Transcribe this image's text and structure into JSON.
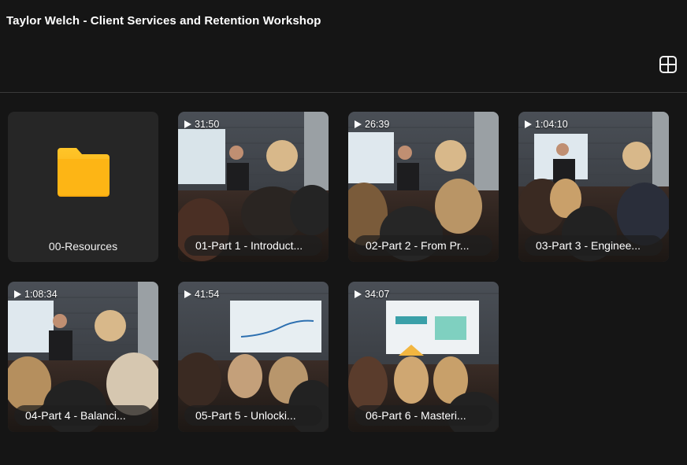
{
  "header": {
    "title": "Taylor Welch - Client Services and Retention Workshop"
  },
  "icons": {
    "layout_toggle": "grid-layout-icon",
    "folder": "folder-icon",
    "play": "play-icon"
  },
  "colors": {
    "background": "#151515",
    "tile": "#232323",
    "folder": "#fbb91a"
  },
  "folder": {
    "label": "00-Resources"
  },
  "videos": [
    {
      "duration": "31:50",
      "label": "01-Part 1 - Introduct..."
    },
    {
      "duration": "26:39",
      "label": "02-Part 2 - From Pr..."
    },
    {
      "duration": "1:04:10",
      "label": "03-Part 3 - Enginee..."
    },
    {
      "duration": "1:08:34",
      "label": "04-Part 4 - Balanci..."
    },
    {
      "duration": "41:54",
      "label": "05-Part 5 - Unlocki..."
    },
    {
      "duration": "34:07",
      "label": "06-Part 6 - Masteri..."
    }
  ]
}
